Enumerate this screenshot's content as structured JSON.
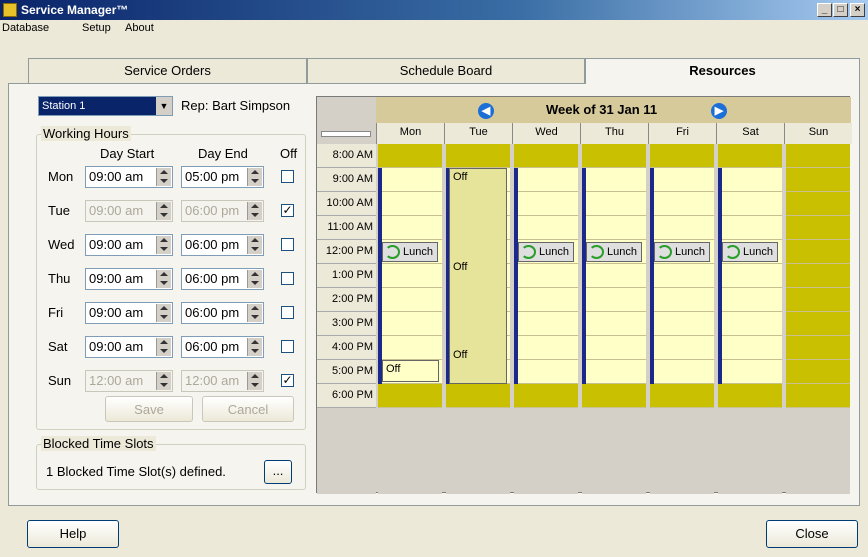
{
  "window": {
    "title": "Service Manager™",
    "min": "_",
    "max": "□",
    "close": "×"
  },
  "menu": [
    "Database",
    "Setup",
    "About"
  ],
  "tabs": {
    "service_orders": "Service Orders",
    "schedule_board": "Schedule Board",
    "resources": "Resources"
  },
  "station": {
    "value": "Station 1",
    "rep": "Rep: Bart Simpson"
  },
  "working_hours": {
    "title": "Working Hours",
    "day_start_header": "Day Start",
    "day_end_header": "Day End",
    "off_header": "Off",
    "days": [
      {
        "day": "Mon",
        "start": "09:00 am",
        "end": "05:00 pm",
        "off": ""
      },
      {
        "day": "Tue",
        "start": "09:00 am",
        "end": "06:00 pm",
        "off": "✓"
      },
      {
        "day": "Wed",
        "start": "09:00 am",
        "end": "06:00 pm",
        "off": ""
      },
      {
        "day": "Thu",
        "start": "09:00 am",
        "end": "06:00 pm",
        "off": ""
      },
      {
        "day": "Fri",
        "start": "09:00 am",
        "end": "06:00 pm",
        "off": ""
      },
      {
        "day": "Sat",
        "start": "09:00 am",
        "end": "06:00 pm",
        "off": ""
      },
      {
        "day": "Sun",
        "start": "12:00 am",
        "end": "12:00 am",
        "off": "✓"
      }
    ],
    "save": "Save",
    "cancel": "Cancel"
  },
  "blocked": {
    "title": "Blocked Time Slots",
    "text": "1 Blocked Time Slot(s) defined.",
    "button": "..."
  },
  "calendar": {
    "week": "Week of 31 Jan 11",
    "prev": "◀",
    "next": "▶",
    "days": [
      "Mon",
      "Tue",
      "Wed",
      "Thu",
      "Fri",
      "Sat",
      "Sun"
    ],
    "times": [
      "8:00 AM",
      "9:00 AM",
      "10:00 AM",
      "11:00 AM",
      "12:00 PM",
      "1:00 PM",
      "2:00 PM",
      "3:00 PM",
      "4:00 PM",
      "5:00 PM",
      "6:00 PM"
    ],
    "lunch": "Lunch",
    "off": "Off"
  },
  "footer": {
    "help": "Help",
    "close": "Close"
  },
  "colors": {
    "olive": "#c8c000",
    "cream": "#ffffc8",
    "tue_off": "#e6e49a"
  }
}
